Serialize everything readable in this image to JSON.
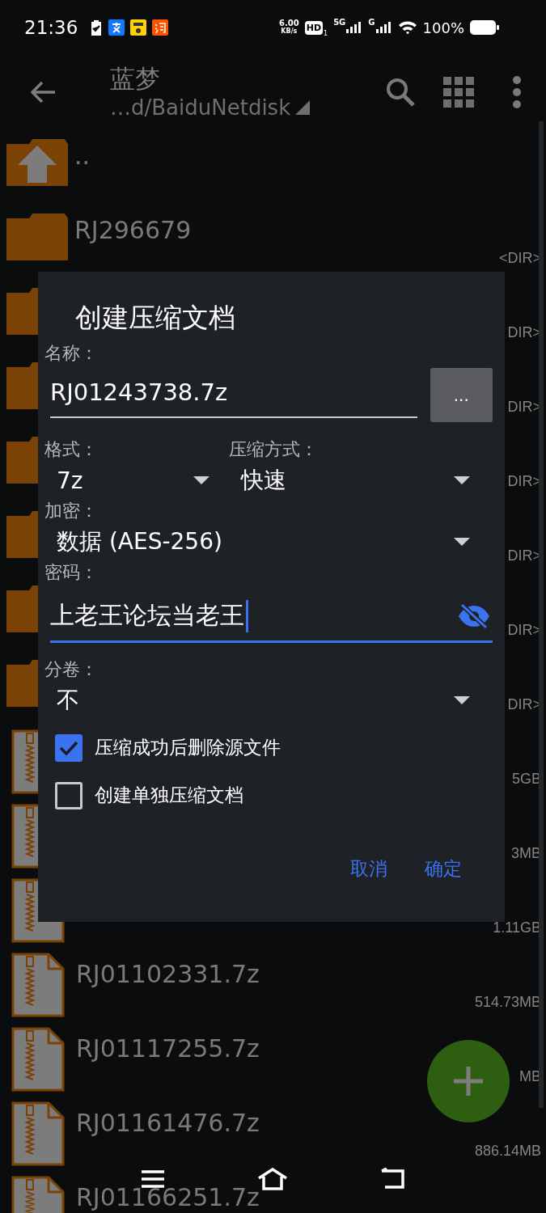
{
  "status_bar": {
    "time": "21:36",
    "net_speed": "6.00",
    "net_unit": "KB/s",
    "hd": "HD",
    "sim": "1",
    "net_1": "5G",
    "net_2": "G",
    "battery": "100%"
  },
  "app_bar": {
    "title": "蓝梦",
    "path": "…d/BaiduNetdisk"
  },
  "files": [
    {
      "kind": "up",
      "name": ".."
    },
    {
      "kind": "folder",
      "name": "RJ296679",
      "size": "<DIR>"
    },
    {
      "kind": "folder",
      "size": "DIR>"
    },
    {
      "kind": "folder",
      "size": "DIR>"
    },
    {
      "kind": "folder",
      "size": "DIR>"
    },
    {
      "kind": "folder",
      "size": "DIR>"
    },
    {
      "kind": "folder",
      "size": "DIR>"
    },
    {
      "kind": "folder",
      "size": "DIR>"
    },
    {
      "kind": "archive",
      "size": "5GB"
    },
    {
      "kind": "archive",
      "size": "3MB"
    },
    {
      "kind": "archive",
      "size": "1.11GB"
    },
    {
      "kind": "archive",
      "name": "RJ01102331.7z",
      "size": "514.73MB"
    },
    {
      "kind": "archive",
      "name": "RJ01117255.7z",
      "size": "MB"
    },
    {
      "kind": "archive",
      "name": "RJ01161476.7z",
      "size": "886.14MB"
    },
    {
      "kind": "archive",
      "name": "RJ01166251.7z"
    }
  ],
  "dialog": {
    "title": "创建压缩文档",
    "name_label": "名称：",
    "name_value": "RJ01243738.7z",
    "browse_button": "...",
    "format_label": "格式：",
    "format_value": "7z",
    "method_label": "压缩方式：",
    "method_value": "快速",
    "encryption_label": "加密：",
    "encryption_value": "数据 (AES-256)",
    "password_label": "密码：",
    "password_value": "上老王论坛当老王",
    "password_focused": true,
    "split_label": "分卷：",
    "split_value": "不",
    "options": [
      {
        "label": "压缩成功后删除源文件",
        "checked": true
      },
      {
        "label": "创建单独压缩文档",
        "checked": false
      }
    ],
    "buttons": [
      "取消",
      "确定"
    ]
  }
}
